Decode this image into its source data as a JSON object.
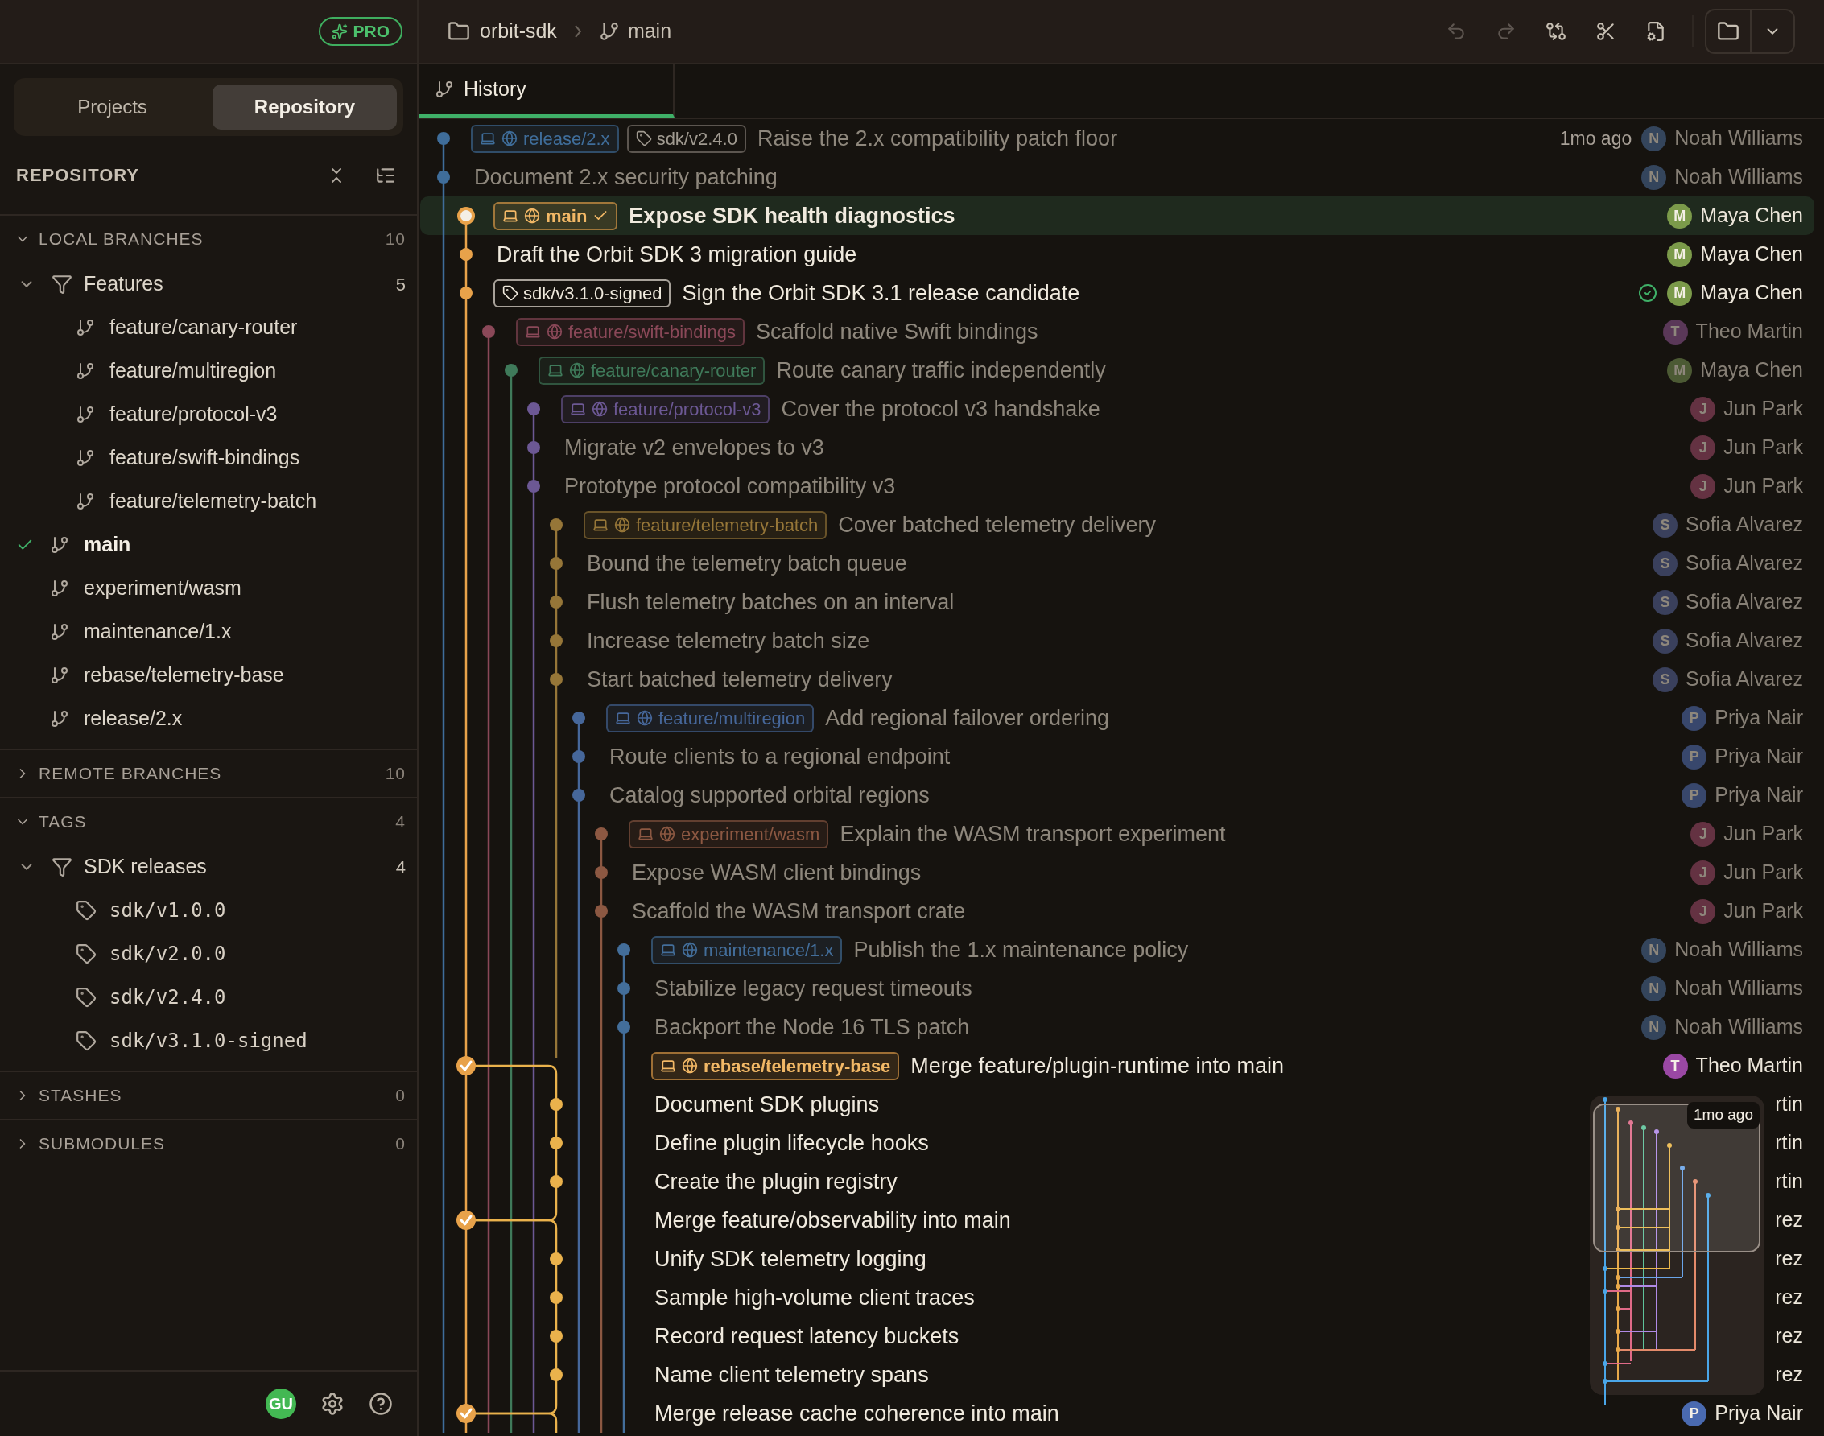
{
  "sidebar": {
    "pro_badge": "PRO",
    "view_tabs": [
      {
        "label": "Projects",
        "selected": false
      },
      {
        "label": "Repository",
        "selected": true
      }
    ],
    "title": "REPOSITORY",
    "sections": [
      {
        "title": "LOCAL BRANCHES",
        "count": "10",
        "expanded": true,
        "items": [
          {
            "kind": "folder",
            "label": "Features",
            "count": "5",
            "expanded": true,
            "children": [
              {
                "kind": "branch",
                "label": "feature/canary-router",
                "current": false
              },
              {
                "kind": "branch",
                "label": "feature/multiregion",
                "current": false
              },
              {
                "kind": "branch",
                "label": "feature/protocol-v3",
                "current": false
              },
              {
                "kind": "branch",
                "label": "feature/swift-bindings",
                "current": false
              },
              {
                "kind": "branch",
                "label": "feature/telemetry-batch",
                "current": false
              }
            ]
          },
          {
            "kind": "branch",
            "label": "main",
            "current": true
          },
          {
            "kind": "branch",
            "label": "experiment/wasm",
            "current": false
          },
          {
            "kind": "branch",
            "label": "maintenance/1.x",
            "current": false
          },
          {
            "kind": "branch",
            "label": "rebase/telemetry-base",
            "current": false
          },
          {
            "kind": "branch",
            "label": "release/2.x",
            "current": false
          }
        ]
      },
      {
        "title": "REMOTE BRANCHES",
        "count": "10",
        "expanded": false
      },
      {
        "title": "TAGS",
        "count": "4",
        "expanded": true,
        "items": [
          {
            "kind": "folder",
            "label": "SDK releases",
            "count": "4",
            "expanded": true,
            "children": [
              {
                "kind": "tag",
                "label": "sdk/v1.0.0"
              },
              {
                "kind": "tag",
                "label": "sdk/v2.0.0"
              },
              {
                "kind": "tag",
                "label": "sdk/v2.4.0"
              },
              {
                "kind": "tag",
                "label": "sdk/v3.1.0-signed"
              }
            ]
          }
        ]
      },
      {
        "title": "STASHES",
        "count": "0",
        "expanded": false
      },
      {
        "title": "SUBMODULES",
        "count": "0",
        "expanded": false
      }
    ],
    "footer": {
      "avatar": "GU"
    }
  },
  "toolbar": {
    "repo": "orbit-sdk",
    "branch": "main",
    "actions": [
      {
        "kind": "undo",
        "disabled": true
      },
      {
        "kind": "redo",
        "disabled": true
      },
      {
        "kind": "compare",
        "disabled": false
      },
      {
        "kind": "cut",
        "disabled": false
      },
      {
        "kind": "file-settings",
        "disabled": false
      }
    ]
  },
  "tabs": [
    {
      "label": "History",
      "selected": true
    }
  ],
  "commits": [
    {
      "refs": [
        {
          "kind": "branch",
          "name": "release/2.x",
          "current": false
        },
        {
          "kind": "tag",
          "name": "sdk/v2.4.0"
        }
      ],
      "message": "Raise the 2.x compatibility patch floor",
      "time": "1mo ago",
      "color": "#3f6d9a",
      "kind": "commit",
      "dimmed": true,
      "selected": false,
      "verified": false,
      "author": {
        "initial": "N",
        "name": "Noah Williams",
        "color": "#34455c"
      }
    },
    {
      "message": "Document 2.x security patching",
      "color": "#3f6d9a",
      "kind": "commit",
      "dimmed": true,
      "selected": false,
      "verified": false,
      "author": {
        "initial": "N",
        "name": "Noah Williams",
        "color": "#34455c"
      }
    },
    {
      "refs": [
        {
          "kind": "branch",
          "name": "main",
          "current": true
        }
      ],
      "message": "Expose SDK health diagnostics",
      "color": "#e8a24a",
      "kind": "commit",
      "dimmed": false,
      "selected": true,
      "verified": false,
      "author": {
        "initial": "M",
        "name": "Maya Chen",
        "color": "#7b9a4a"
      }
    },
    {
      "message": "Draft the Orbit SDK 3 migration guide",
      "color": "#e8a24a",
      "kind": "commit",
      "dimmed": false,
      "selected": false,
      "verified": false,
      "author": {
        "initial": "M",
        "name": "Maya Chen",
        "color": "#7b9a4a"
      }
    },
    {
      "refs": [
        {
          "kind": "tag",
          "name": "sdk/v3.1.0-signed"
        }
      ],
      "message": "Sign the Orbit SDK 3.1 release candidate",
      "color": "#e8a24a",
      "kind": "commit",
      "dimmed": false,
      "selected": false,
      "verified": true,
      "author": {
        "initial": "M",
        "name": "Maya Chen",
        "color": "#7b9a4a"
      }
    },
    {
      "refs": [
        {
          "kind": "branch",
          "name": "feature/swift-bindings",
          "current": false
        }
      ],
      "message": "Scaffold native Swift bindings",
      "color": "#8a4858",
      "kind": "commit",
      "dimmed": true,
      "selected": false,
      "verified": false,
      "author": {
        "initial": "T",
        "name": "Theo Martin",
        "color": "#5a3858"
      }
    },
    {
      "refs": [
        {
          "kind": "branch",
          "name": "feature/canary-router",
          "current": false
        }
      ],
      "message": "Route canary traffic independently",
      "color": "#3f7a5a",
      "kind": "commit",
      "dimmed": true,
      "selected": false,
      "verified": false,
      "author": {
        "initial": "M",
        "name": "Maya Chen",
        "color": "#4c5a34"
      }
    },
    {
      "refs": [
        {
          "kind": "branch",
          "name": "feature/protocol-v3",
          "current": false
        }
      ],
      "message": "Cover the protocol v3 handshake",
      "color": "#6c5894",
      "kind": "commit",
      "dimmed": true,
      "selected": false,
      "verified": false,
      "author": {
        "initial": "J",
        "name": "Jun Park",
        "color": "#643242"
      }
    },
    {
      "message": "Migrate v2 envelopes to v3",
      "color": "#6c5894",
      "kind": "commit",
      "dimmed": true,
      "selected": false,
      "verified": false,
      "author": {
        "initial": "J",
        "name": "Jun Park",
        "color": "#643242"
      }
    },
    {
      "message": "Prototype protocol compatibility v3",
      "color": "#6c5894",
      "kind": "commit",
      "dimmed": true,
      "selected": false,
      "verified": false,
      "author": {
        "initial": "J",
        "name": "Jun Park",
        "color": "#643242"
      }
    },
    {
      "refs": [
        {
          "kind": "branch",
          "name": "feature/telemetry-batch",
          "current": false
        }
      ],
      "message": "Cover batched telemetry delivery",
      "color": "#967638",
      "kind": "commit",
      "dimmed": true,
      "selected": false,
      "verified": false,
      "author": {
        "initial": "S",
        "name": "Sofia Alvarez",
        "color": "#3a405c"
      }
    },
    {
      "message": "Bound the telemetry batch queue",
      "color": "#967638",
      "kind": "commit",
      "dimmed": true,
      "selected": false,
      "verified": false,
      "author": {
        "initial": "S",
        "name": "Sofia Alvarez",
        "color": "#3a405c"
      }
    },
    {
      "message": "Flush telemetry batches on an interval",
      "color": "#967638",
      "kind": "commit",
      "dimmed": true,
      "selected": false,
      "verified": false,
      "author": {
        "initial": "S",
        "name": "Sofia Alvarez",
        "color": "#3a405c"
      }
    },
    {
      "message": "Increase telemetry batch size",
      "color": "#967638",
      "kind": "commit",
      "dimmed": true,
      "selected": false,
      "verified": false,
      "author": {
        "initial": "S",
        "name": "Sofia Alvarez",
        "color": "#3a405c"
      }
    },
    {
      "message": "Start batched telemetry delivery",
      "color": "#967638",
      "kind": "commit",
      "dimmed": true,
      "selected": false,
      "verified": false,
      "author": {
        "initial": "S",
        "name": "Sofia Alvarez",
        "color": "#3a405c"
      }
    },
    {
      "refs": [
        {
          "kind": "branch",
          "name": "feature/multiregion",
          "current": false
        }
      ],
      "message": "Add regional failover ordering",
      "color": "#46679a",
      "kind": "commit",
      "dimmed": true,
      "selected": false,
      "verified": false,
      "author": {
        "initial": "P",
        "name": "Priya Nair",
        "color": "#38476c"
      }
    },
    {
      "message": "Route clients to a regional endpoint",
      "color": "#46679a",
      "kind": "commit",
      "dimmed": true,
      "selected": false,
      "verified": false,
      "author": {
        "initial": "P",
        "name": "Priya Nair",
        "color": "#38476c"
      }
    },
    {
      "message": "Catalog supported orbital regions",
      "color": "#46679a",
      "kind": "commit",
      "dimmed": true,
      "selected": false,
      "verified": false,
      "author": {
        "initial": "P",
        "name": "Priya Nair",
        "color": "#38476c"
      }
    },
    {
      "refs": [
        {
          "kind": "branch",
          "name": "experiment/wasm",
          "current": false
        }
      ],
      "message": "Explain the WASM transport experiment",
      "color": "#8c5842",
      "kind": "commit",
      "dimmed": true,
      "selected": false,
      "verified": false,
      "author": {
        "initial": "J",
        "name": "Jun Park",
        "color": "#643242"
      }
    },
    {
      "message": "Expose WASM client bindings",
      "color": "#8c5842",
      "kind": "commit",
      "dimmed": true,
      "selected": false,
      "verified": false,
      "author": {
        "initial": "J",
        "name": "Jun Park",
        "color": "#643242"
      }
    },
    {
      "message": "Scaffold the WASM transport crate",
      "color": "#8c5842",
      "kind": "commit",
      "dimmed": true,
      "selected": false,
      "verified": false,
      "author": {
        "initial": "J",
        "name": "Jun Park",
        "color": "#643242"
      }
    },
    {
      "refs": [
        {
          "kind": "branch",
          "name": "maintenance/1.x",
          "current": false
        }
      ],
      "message": "Publish the 1.x maintenance policy",
      "color": "#436e9a",
      "kind": "commit",
      "dimmed": true,
      "selected": false,
      "verified": false,
      "author": {
        "initial": "N",
        "name": "Noah Williams",
        "color": "#34455c"
      }
    },
    {
      "message": "Stabilize legacy request timeouts",
      "color": "#436e9a",
      "kind": "commit",
      "dimmed": true,
      "selected": false,
      "verified": false,
      "author": {
        "initial": "N",
        "name": "Noah Williams",
        "color": "#34455c"
      }
    },
    {
      "message": "Backport the Node 16 TLS patch",
      "color": "#436e9a",
      "kind": "commit",
      "dimmed": true,
      "selected": false,
      "verified": false,
      "author": {
        "initial": "N",
        "name": "Noah Williams",
        "color": "#34455c"
      }
    },
    {
      "refs": [
        {
          "kind": "branch",
          "name": "rebase/telemetry-base",
          "current": false
        }
      ],
      "message": "Merge feature/plugin-runtime into main",
      "color": "#e8a24a",
      "kind": "merge",
      "dimmed": false,
      "selected": false,
      "verified": false,
      "author": {
        "initial": "T",
        "name": "Theo Martin",
        "color": "#9a48a4"
      }
    },
    {
      "message": "Document SDK plugins",
      "color": "#eab24c",
      "kind": "commit",
      "dimmed": false,
      "selected": false,
      "verified": false,
      "author": {
        "name": "rtin"
      }
    },
    {
      "message": "Define plugin lifecycle hooks",
      "color": "#eab24c",
      "kind": "commit",
      "dimmed": false,
      "selected": false,
      "verified": false,
      "author": {
        "name": "rtin"
      }
    },
    {
      "message": "Create the plugin registry",
      "color": "#eab24c",
      "kind": "commit",
      "dimmed": false,
      "selected": false,
      "verified": false,
      "author": {
        "name": "rtin"
      }
    },
    {
      "message": "Merge feature/observability into main",
      "color": "#e8a24a",
      "kind": "merge",
      "dimmed": false,
      "selected": false,
      "verified": false,
      "author": {
        "name": "rez"
      }
    },
    {
      "message": "Unify SDK telemetry logging",
      "color": "#eab24c",
      "kind": "commit",
      "dimmed": false,
      "selected": false,
      "verified": false,
      "author": {
        "name": "rez"
      }
    },
    {
      "message": "Sample high-volume client traces",
      "color": "#eab24c",
      "kind": "commit",
      "dimmed": false,
      "selected": false,
      "verified": false,
      "author": {
        "name": "rez"
      }
    },
    {
      "message": "Record request latency buckets",
      "color": "#eab24c",
      "kind": "commit",
      "dimmed": false,
      "selected": false,
      "verified": false,
      "author": {
        "name": "rez"
      }
    },
    {
      "message": "Name client telemetry spans",
      "color": "#eab24c",
      "kind": "commit",
      "dimmed": false,
      "selected": false,
      "verified": false,
      "author": {
        "name": "rez"
      }
    },
    {
      "message": "Merge release cache coherence into main",
      "color": "#e8a24a",
      "kind": "merge",
      "dimmed": false,
      "selected": false,
      "verified": false,
      "author": {
        "initial": "P",
        "name": "Priya Nair",
        "color": "#4a6ab0"
      }
    }
  ],
  "minimap": {
    "tooltip": "1mo ago"
  }
}
